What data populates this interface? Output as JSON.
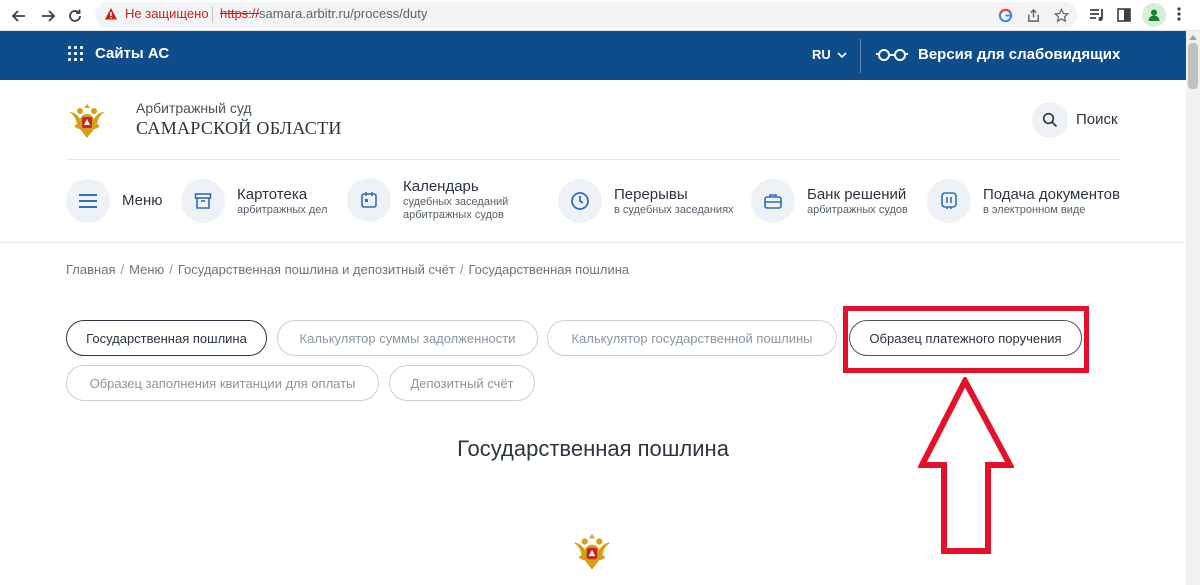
{
  "browser": {
    "security_label": "Не защищено",
    "url_protocol": "https://",
    "url_rest": "samara.arbitr.ru/process/duty"
  },
  "topbar": {
    "sites_label": "Сайты АС",
    "lang_label": "RU",
    "vision_label": "Версия для слабовидящих"
  },
  "court": {
    "line1": "Арбитражный суд",
    "line2": "САМАРСКОЙ ОБЛАСТИ"
  },
  "search": {
    "label": "Поиск"
  },
  "menu": {
    "items": [
      {
        "title": "Меню",
        "sub1": "",
        "sub2": ""
      },
      {
        "title": "Картотека",
        "sub1": "арбитражных дел",
        "sub2": ""
      },
      {
        "title": "Календарь",
        "sub1": "судебных заседаний",
        "sub2": "арбитражных судов"
      },
      {
        "title": "Перерывы",
        "sub1": "в судебных заседаниях",
        "sub2": ""
      },
      {
        "title": "Банк решений",
        "sub1": "арбитражных судов",
        "sub2": ""
      },
      {
        "title": "Подача документов",
        "sub1": "в электронном виде",
        "sub2": ""
      }
    ]
  },
  "breadcrumb": {
    "items": [
      "Главная",
      "Меню",
      "Государственная пошлина и депозитный счёт",
      "Государственная пошлина"
    ]
  },
  "tabs": [
    {
      "label": "Государственная пошлина"
    },
    {
      "label": "Калькулятор суммы задолженности"
    },
    {
      "label": "Калькулятор государственной пошлины"
    },
    {
      "label": "Образец платежного поручения"
    },
    {
      "label": "Образец заполнения квитанции для оплаты"
    },
    {
      "label": "Депозитный счёт"
    }
  ],
  "page": {
    "title": "Государственная пошлина"
  },
  "colors": {
    "topbar": "#0f4c8a",
    "annotation": "#e3122a",
    "accent_gold": "#d4a017"
  }
}
